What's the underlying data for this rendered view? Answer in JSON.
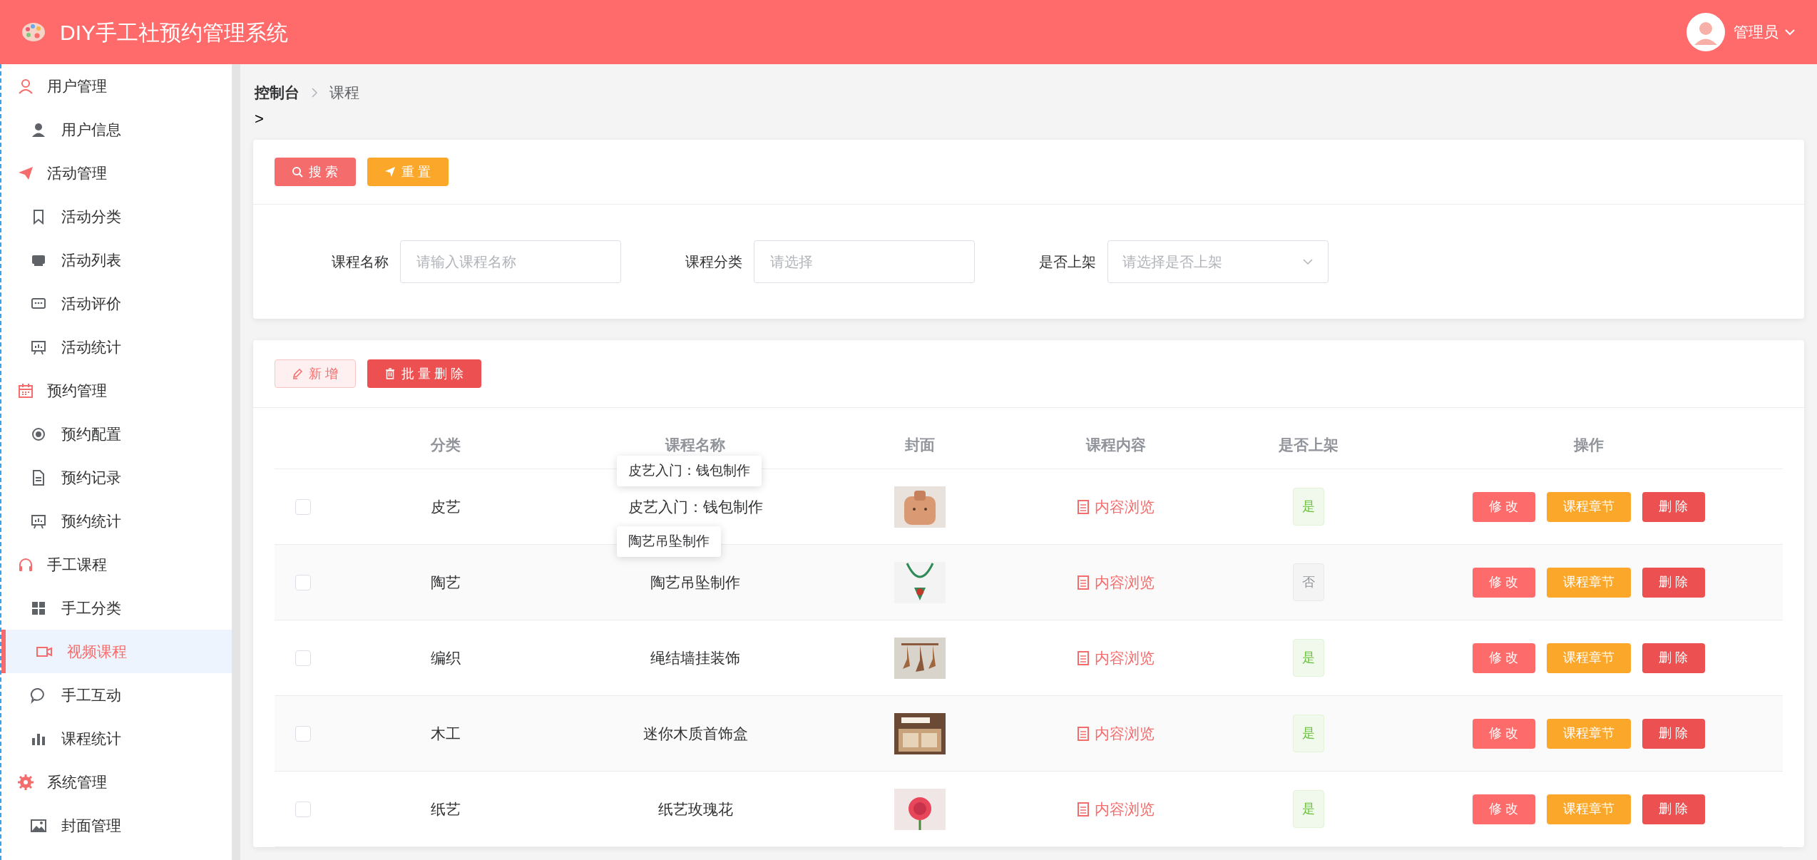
{
  "header": {
    "title": "DIY手工社预约管理系统",
    "user": "管理员"
  },
  "sidebar": {
    "groups": [
      {
        "label": "用户管理",
        "children": [
          {
            "label": "用户信息",
            "selected": false
          }
        ]
      },
      {
        "label": "活动管理",
        "children": [
          {
            "label": "活动分类",
            "selected": false
          },
          {
            "label": "活动列表",
            "selected": false
          },
          {
            "label": "活动评价",
            "selected": false
          },
          {
            "label": "活动统计",
            "selected": false
          }
        ]
      },
      {
        "label": "预约管理",
        "children": [
          {
            "label": "预约配置",
            "selected": false
          },
          {
            "label": "预约记录",
            "selected": false
          },
          {
            "label": "预约统计",
            "selected": false
          }
        ]
      },
      {
        "label": "手工课程",
        "children": [
          {
            "label": "手工分类",
            "selected": false
          },
          {
            "label": "视频课程",
            "selected": true
          },
          {
            "label": "手工互动",
            "selected": false
          },
          {
            "label": "课程统计",
            "selected": false
          }
        ]
      },
      {
        "label": "系统管理",
        "children": [
          {
            "label": "封面管理",
            "selected": false
          }
        ]
      }
    ]
  },
  "breadcrumb": [
    "控制台",
    "课程"
  ],
  "breadcrumb_extra": ">",
  "search_buttons": [
    "搜 索",
    "重 置"
  ],
  "filters": [
    {
      "label": "课程名称",
      "kind": "input",
      "placeholder": "请输入课程名称"
    },
    {
      "label": "课程分类",
      "kind": "input",
      "placeholder": "请选择"
    },
    {
      "label": "是否上架",
      "kind": "select",
      "placeholder": "请选择是否上架"
    }
  ],
  "actions": [
    "新 增",
    "批 量 删 除"
  ],
  "table": {
    "columns": [
      "分类",
      "课程名称",
      "封面",
      "课程内容",
      "是否上架",
      "操作"
    ],
    "rows": [
      {
        "checked": false,
        "category": "皮艺",
        "name": "皮艺入门：钱包制作",
        "content": "内容浏览",
        "status": "是",
        "listed": true,
        "buttons": [
          "修 改",
          "课程章节",
          "删 除"
        ]
      },
      {
        "checked": false,
        "category": "陶艺",
        "name": "陶艺吊坠制作",
        "content": "内容浏览",
        "status": "否",
        "listed": false,
        "buttons": [
          "修 改",
          "课程章节",
          "删 除"
        ]
      },
      {
        "checked": false,
        "category": "编织",
        "name": "绳结墙挂装饰",
        "content": "内容浏览",
        "status": "是",
        "listed": true,
        "buttons": [
          "修 改",
          "课程章节",
          "删 除"
        ]
      },
      {
        "checked": false,
        "category": "木工",
        "name": "迷你木质首饰盒",
        "content": "内容浏览",
        "status": "是",
        "listed": true,
        "buttons": [
          "修 改",
          "课程章节",
          "删 除"
        ]
      },
      {
        "checked": false,
        "category": "纸艺",
        "name": "纸艺玫瑰花",
        "content": "内容浏览",
        "status": "是",
        "listed": true,
        "buttons": [
          "修 改",
          "课程章节",
          "删 除"
        ]
      }
    ]
  },
  "tooltips": [
    "皮艺入门：钱包制作",
    "陶艺吊坠制作"
  ]
}
